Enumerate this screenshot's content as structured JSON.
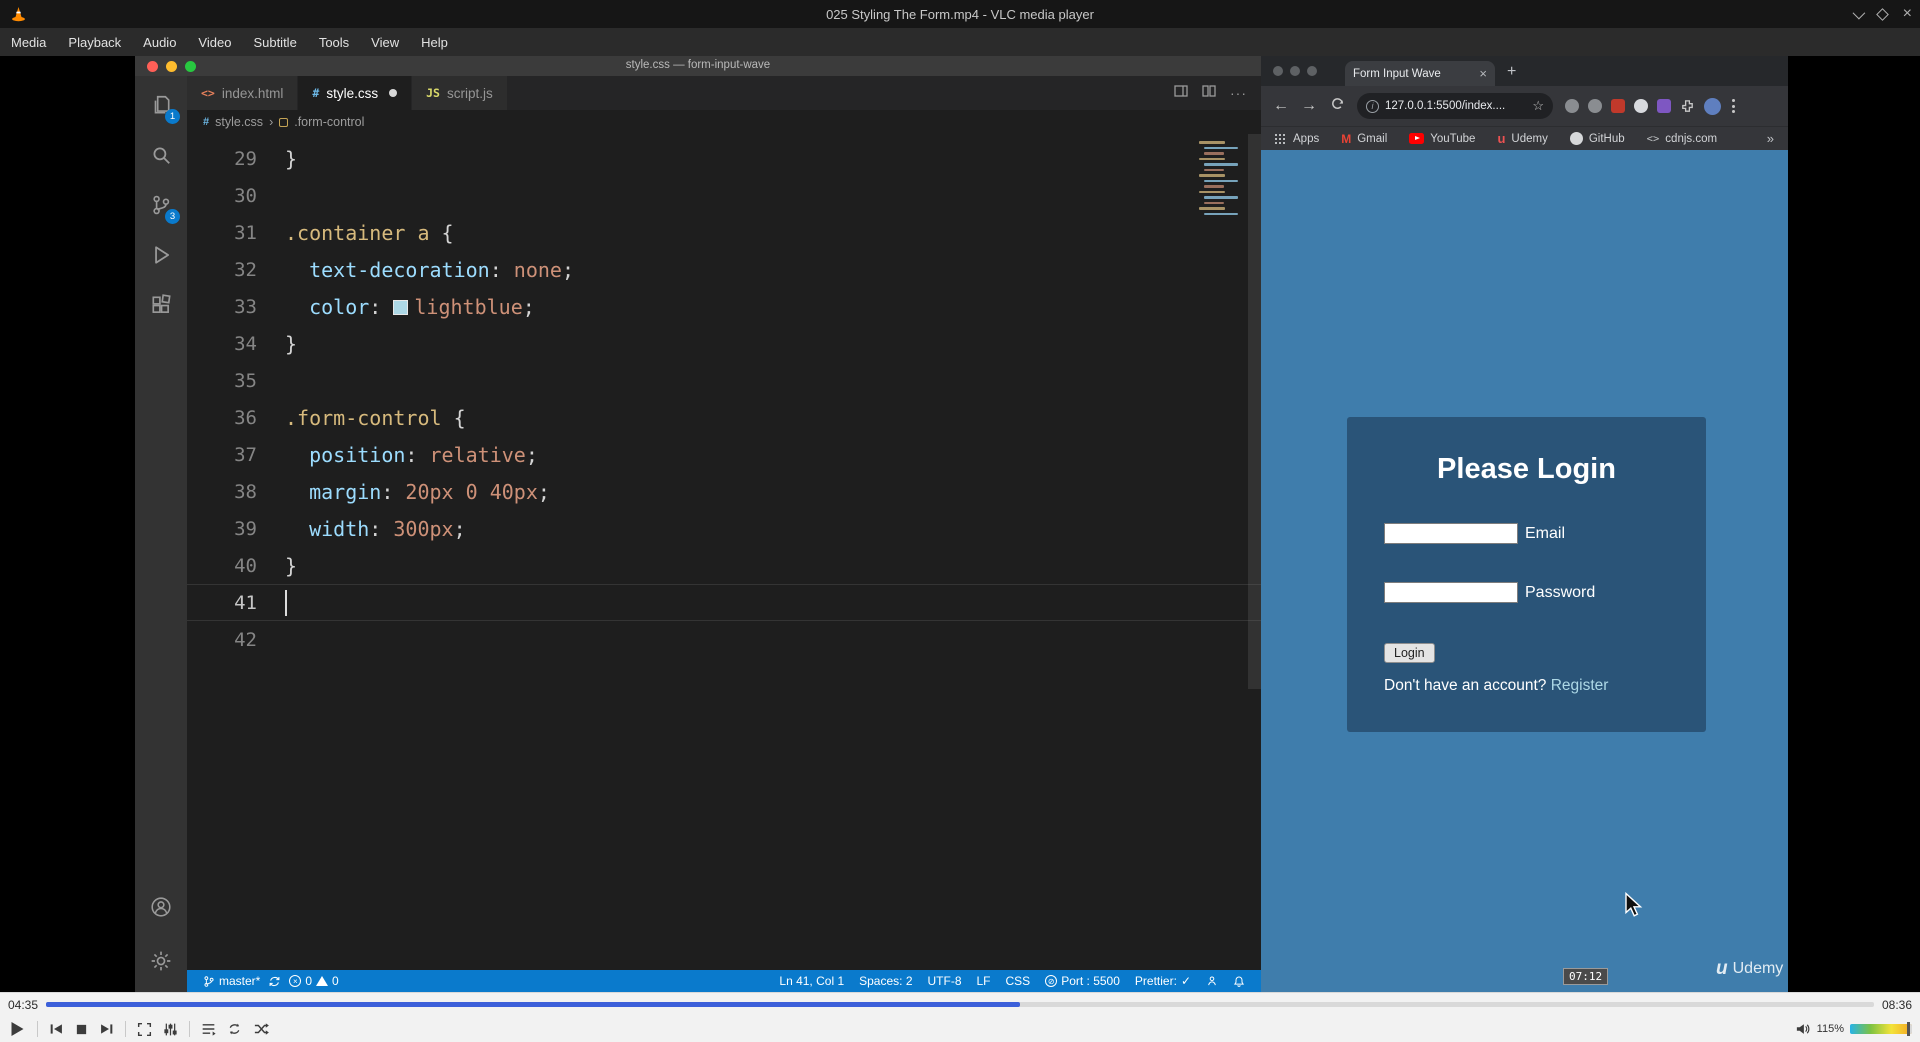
{
  "vlc": {
    "app_title": "025 Styling The Form.mp4 - VLC media player",
    "menu_items": [
      "Media",
      "Playback",
      "Audio",
      "Video",
      "Subtitle",
      "Tools",
      "View",
      "Help"
    ],
    "current_time": "04:35",
    "total_time": "08:36",
    "progress_percent": 53.3,
    "volume_label": "115%",
    "volume_percent": 92
  },
  "vscode": {
    "window_title": "style.css — form-input-wave",
    "explorer_badge": "1",
    "scm_badge": "3",
    "tabs": [
      {
        "label": "index.html",
        "icon": "<>",
        "icon_color": "#e8815c",
        "active": false,
        "modified": false
      },
      {
        "label": "style.css",
        "icon": "#",
        "icon_color": "#6cb8e6",
        "active": true,
        "modified": true
      },
      {
        "label": "script.js",
        "icon": "JS",
        "icon_color": "#d9d96a",
        "active": false,
        "modified": false
      }
    ],
    "breadcrumb_file": "style.css",
    "breadcrumb_separator": "›",
    "breadcrumb_symbol": ".form-control",
    "tab_actions_more": "···",
    "code_lines": [
      {
        "n": 29,
        "tokens": [
          [
            "punct",
            "}"
          ]
        ]
      },
      {
        "n": 30,
        "tokens": []
      },
      {
        "n": 31,
        "tokens": [
          [
            "sel",
            ".container a"
          ],
          [
            "punct",
            " {"
          ]
        ]
      },
      {
        "n": 32,
        "tokens": [
          [
            "prop",
            "  text-decoration"
          ],
          [
            "punct",
            ": "
          ],
          [
            "val",
            "none"
          ],
          [
            "punct",
            ";"
          ]
        ]
      },
      {
        "n": 33,
        "tokens": [
          [
            "prop",
            "  color"
          ],
          [
            "punct",
            ": "
          ],
          [
            "swatch",
            "#add8e6"
          ],
          [
            "val",
            "lightblue"
          ],
          [
            "punct",
            ";"
          ]
        ]
      },
      {
        "n": 34,
        "tokens": [
          [
            "punct",
            "}"
          ]
        ]
      },
      {
        "n": 35,
        "tokens": []
      },
      {
        "n": 36,
        "tokens": [
          [
            "sel",
            ".form-control"
          ],
          [
            "punct",
            " {"
          ]
        ]
      },
      {
        "n": 37,
        "tokens": [
          [
            "prop",
            "  position"
          ],
          [
            "punct",
            ": "
          ],
          [
            "val",
            "relative"
          ],
          [
            "punct",
            ";"
          ]
        ]
      },
      {
        "n": 38,
        "tokens": [
          [
            "prop",
            "  margin"
          ],
          [
            "punct",
            ": "
          ],
          [
            "val",
            "20px 0 40px"
          ],
          [
            "punct",
            ";"
          ]
        ]
      },
      {
        "n": 39,
        "tokens": [
          [
            "prop",
            "  width"
          ],
          [
            "punct",
            ": "
          ],
          [
            "val",
            "300px"
          ],
          [
            "punct",
            ";"
          ]
        ]
      },
      {
        "n": 40,
        "tokens": [
          [
            "punct",
            "}"
          ]
        ]
      },
      {
        "n": 41,
        "tokens": [],
        "current": true,
        "cursor": true
      },
      {
        "n": 42,
        "tokens": []
      }
    ],
    "status": {
      "branch": "master*",
      "errors": "0",
      "warnings": "0",
      "cursor_pos": "Ln 41, Col 1",
      "indent": "Spaces: 2",
      "encoding": "UTF-8",
      "eol": "LF",
      "language": "CSS",
      "port": "Port : 5500",
      "prettier": "Prettier:",
      "prettier_check": "✓"
    }
  },
  "chrome": {
    "tab_title": "Form Input Wave",
    "tab_close": "×",
    "new_tab": "+",
    "back": "←",
    "forward": "→",
    "url": "127.0.0.1:5500/index....",
    "star": "☆",
    "info": "i",
    "bookmarks": [
      {
        "label": "Apps",
        "icon": "apps"
      },
      {
        "label": "Gmail",
        "icon": "gmail"
      },
      {
        "label": "YouTube",
        "icon": "youtube"
      },
      {
        "label": "Udemy",
        "icon": "udemy"
      },
      {
        "label": "GitHub",
        "icon": "github"
      },
      {
        "label": "cdnjs.com",
        "icon": "code"
      }
    ],
    "bookmarks_overflow": "»",
    "page": {
      "heading": "Please Login",
      "email_label": "Email",
      "password_label": "Password",
      "login_button": "Login",
      "register_question": "Don't have an account? ",
      "register_link": "Register",
      "background_color": "#3f7dac",
      "card_color": "#2a5478",
      "link_color": "#add8e6"
    }
  },
  "video_overlays": {
    "timestamp": "07:12",
    "watermark_mark": "u",
    "watermark_text": "Udemy"
  }
}
